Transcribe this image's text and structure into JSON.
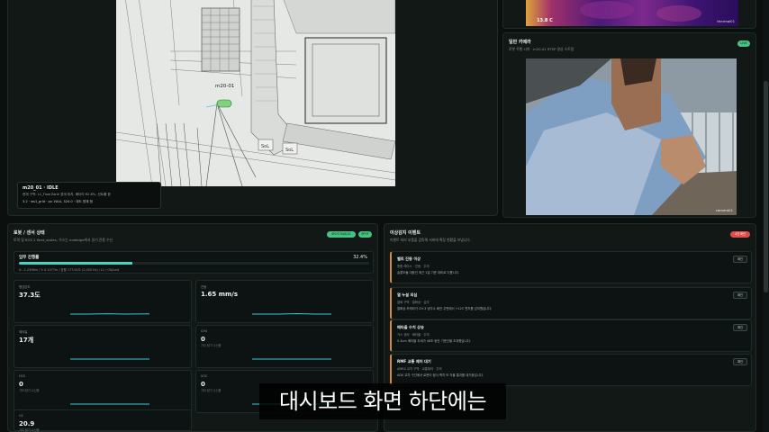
{
  "map": {
    "robot_marker_label": "m20-01",
    "building_label_1": "SoL",
    "building_label_2": "SoL",
    "status_title": "m20_01 · IDLE",
    "status_line1": "현재 구역: L1_FloorZone 경계 위치, 배터리 62.8%, 컨트롤 중",
    "status_line2": "3.2 · ws1_grid · px 1W.A, 320.0 · 대도 방재 청"
  },
  "thermal": {
    "temp_label": "13.8 C",
    "camera_id": "thermal01"
  },
  "camera": {
    "title": "일반 카메라",
    "subtitle": "로봇 주행 시야 · m20-01 RTSP 영상 스트림",
    "live_badge": "LIVE",
    "camera_id": "camera01"
  },
  "robot": {
    "title": "로봇 / 센서 상태",
    "subtitle": "토픽 및 ROS 2 fleet_states, 가스는 nodedge에서 읽기 전용 수신",
    "badge_1": "SPOT-TASK-01",
    "badge_2": "SPOT",
    "progress": {
      "label": "임무 진행률",
      "percent_text": "32.4%",
      "fraction": 0.324,
      "detail": "X: -1.2398m / Y: 0.1077m / 방향 177.91도 (2,000 Hz) / L1 / ON/unit"
    },
    "sensors": [
      {
        "label": "평균온도",
        "value": "37.3도",
        "note": ""
      },
      {
        "label": "진동",
        "value": "1.65 mm/s",
        "note": ""
      },
      {
        "label": "메타일",
        "value": "17개",
        "note": ""
      },
      {
        "label": "CH4",
        "value": "0",
        "note": "기타 탐기 수신중"
      },
      {
        "label": "H2S",
        "value": "0",
        "note": "기타 탐기 수신중"
      },
      {
        "label": "VOC",
        "value": "0",
        "note": "기타 탐기 수신중"
      },
      {
        "label": "O2",
        "value": "20.9",
        "note": "기타 탐기 수신중"
      }
    ]
  },
  "events": {
    "title": "이상감지 이벤트",
    "subtitle": "이벤트 처리 부품을 감독해 서버에 확장 현황을 보냅니다.",
    "alert_badge": "4건 확인",
    "items": [
      {
        "title": "벨트 진동 이상",
        "meta": "종합 레이스 · 진동 · 주의",
        "desc": "슬롯모듈 대등인 최근 1일 기준 대비로 다릅니다.",
        "action": "확인"
      },
      {
        "title": "열 누설 의심",
        "meta": "열화 구역 · 열화상 · 심각",
        "desc": "열화상 카메라가 CH-3 냉각수 배관 주변에서 +12C 편차를 감지했습니다.",
        "action": "확인"
      },
      {
        "title": "메타올 수치 상승",
        "meta": "가스 센서 · 메타올 · 주의",
        "desc": "0.3um 메타올 추세가 48초 동안 기준선을 초과했습니다.",
        "action": "확인"
      },
      {
        "title": "RMF 교통 제어 대기",
        "meta": "AMRS 교차 구역 · 교통제어 · 주의",
        "desc": "ADV 교차 구간에서 로봇이 탐사 벽치 또 자율 통과를 대기중입니다.",
        "action": "확인"
      }
    ]
  },
  "subtitle_caption": "대시보드 화면 하단에는",
  "colors": {
    "accent": "#3fd6c4",
    "live_green": "#45c383",
    "alert_red": "#e04b4b",
    "event_orange": "#d58a3a",
    "background": "#0b100f"
  }
}
